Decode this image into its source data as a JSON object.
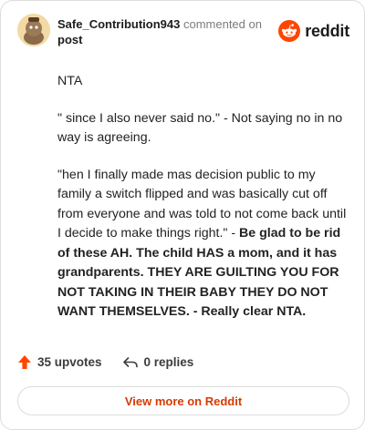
{
  "comment": {
    "author": "Safe_Contribution943",
    "action": " commented on",
    "post_link": "post",
    "paragraphs": [
      {
        "text": "NTA",
        "bold": ""
      },
      {
        "text": "\" since I also never said no.\" - Not saying no in no way is agreeing.",
        "bold": ""
      },
      {
        "text": "\"hen I finally made mas decision public to my family a switch flipped and was basically cut off from everyone and was told to not come back until I decide to make things right.\" - ",
        "bold": "Be glad to be rid of these AH. The child HAS a mom, and it has grandparents. THEY ARE GUILTING YOU FOR NOT TAKING IN THEIR BABY THEY DO NOT WANT THEMSELVES. - Really clear NTA."
      }
    ],
    "upvotes": "35 upvotes",
    "replies": "0 replies"
  },
  "brand": {
    "name": "reddit",
    "color": "#ff4500"
  },
  "view_more": "View more on Reddit",
  "colors": {
    "accent": "#d93a00",
    "upvote": "#ff4500",
    "muted": "#7c7c7c"
  },
  "icons": {
    "avatar": "snoo-avatar",
    "logo": "reddit-logo-icon",
    "upvote": "upvote-arrow-icon",
    "reply": "reply-arrow-icon"
  }
}
